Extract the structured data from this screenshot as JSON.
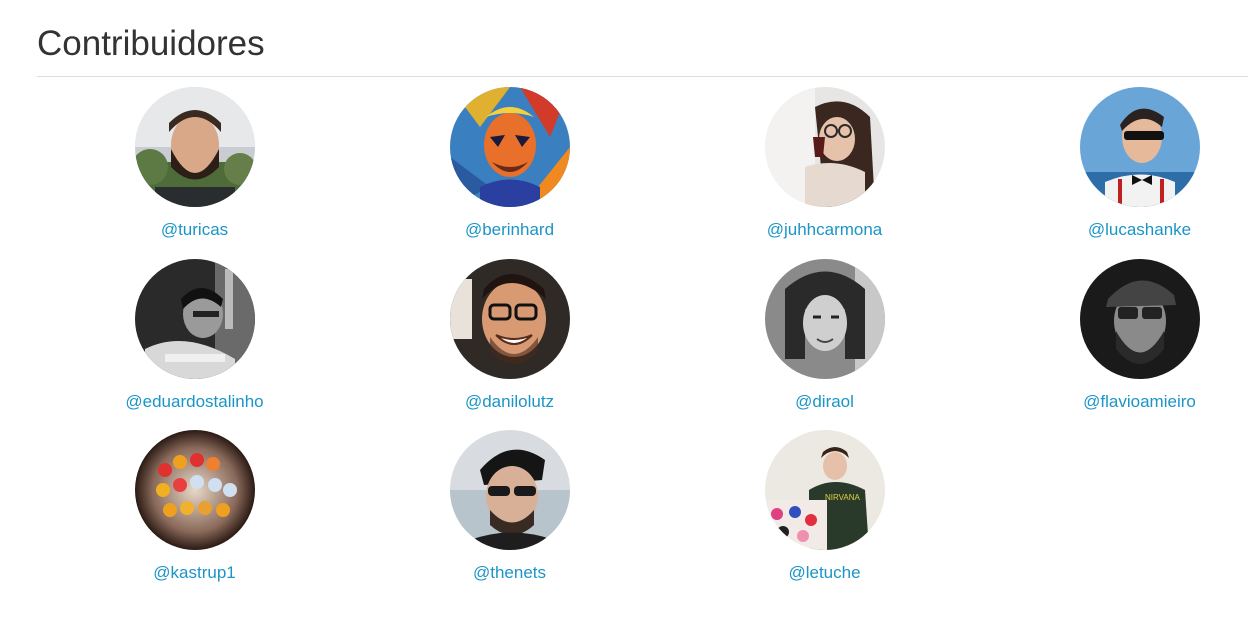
{
  "section": {
    "title": "Contribuidores"
  },
  "link_color": "#1a95c6",
  "contributors": [
    {
      "handle": "@turicas",
      "avatar": "person-photo-bearded-man-outdoors"
    },
    {
      "handle": "@berinhard",
      "avatar": "psychedelic-portrait-art"
    },
    {
      "handle": "@juhhcarmona",
      "avatar": "woman-with-glasses-drinking"
    },
    {
      "handle": "@lucashanke",
      "avatar": "man-sunglasses-bowtie"
    },
    {
      "handle": "@eduardostalinho",
      "avatar": "black-and-white-man-reading"
    },
    {
      "handle": "@danilolutz",
      "avatar": "smiling-man-glasses"
    },
    {
      "handle": "@diraol",
      "avatar": "black-and-white-long-hair-man"
    },
    {
      "handle": "@flavioamieiro",
      "avatar": "black-and-white-man-cap-glasses"
    },
    {
      "handle": "@kastrup1",
      "avatar": "colorful-figurines-sphere"
    },
    {
      "handle": "@thenets",
      "avatar": "man-sunglasses-beach"
    },
    {
      "handle": "@letuche",
      "avatar": "woman-laptop-nirvana-shirt"
    }
  ]
}
